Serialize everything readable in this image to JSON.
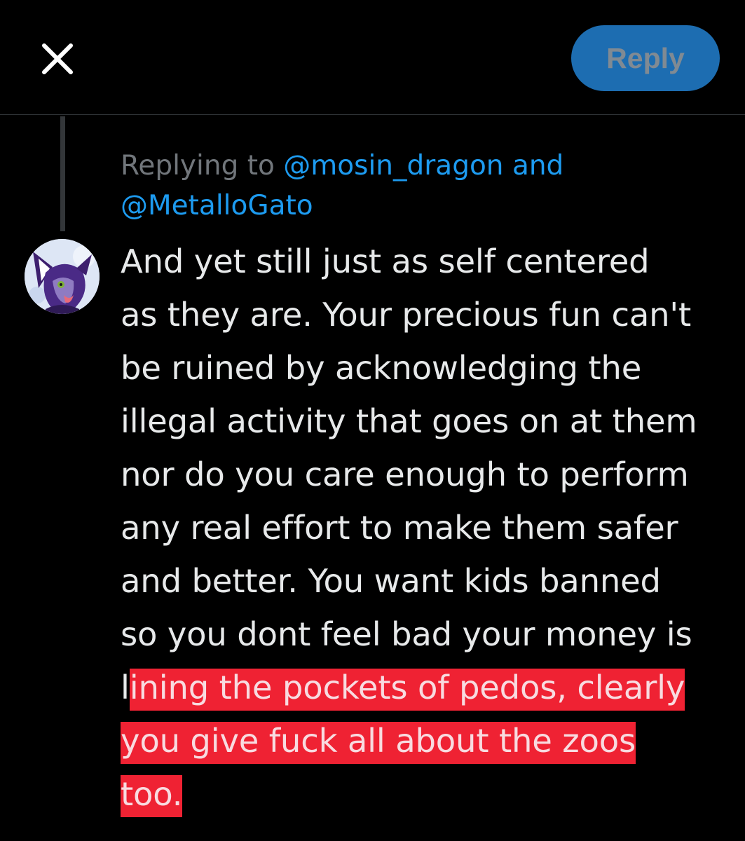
{
  "header": {
    "close_icon": "close-icon",
    "reply_label": "Reply"
  },
  "reply_context": {
    "prefix": "Replying to",
    "mention_1": "@mosin_dragon",
    "conjunction": "and",
    "mention_2": "@MetalloGato"
  },
  "tweet": {
    "avatar_icon": "furry-avatar-icon",
    "lines": [
      "And yet still just as self centered",
      "as they are. Your precious fun can't",
      "be ruined by acknowledging the",
      "illegal activity that goes on at them",
      "nor do you care enough to perform",
      "any real effort to make them safer",
      "and better. You want kids banned",
      "so you dont feel bad your money is"
    ],
    "line9_plain": "l",
    "line9_highlight": "ining the pockets of pedos, clearly",
    "line10_highlight": "you give fuck all about the zoos",
    "line11_highlight": "too."
  },
  "colors": {
    "background": "#000000",
    "reply_button": "#1d6db1",
    "mention": "#1d9bf0",
    "highlight": "#ef2233"
  }
}
